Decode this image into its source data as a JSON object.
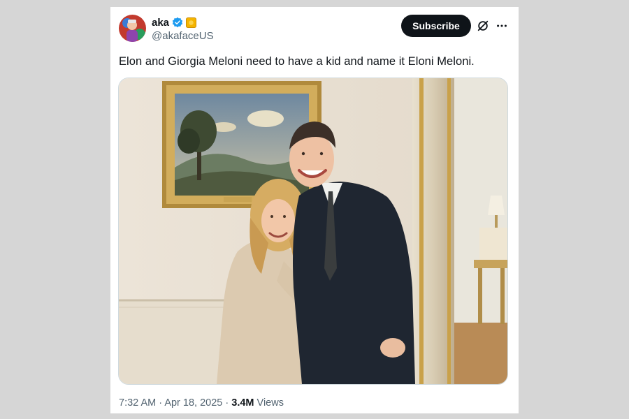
{
  "tweet": {
    "author": {
      "display_name": "aka",
      "handle": "@akafaceUS",
      "verified": true,
      "badge": "orange-square-badge",
      "avatar_icon": "avatar-icon"
    },
    "subscribe_label": "Subscribe",
    "text": "Elon and Giorgia Meloni need to have a kid and name it Eloni Meloni.",
    "time": "7:32 AM",
    "date": "Apr 18, 2025",
    "views_count": "3.4M",
    "views_label": "Views",
    "separator": "·"
  },
  "colors": {
    "subscribe_bg": "#0f1419",
    "verified": "#1d9bf0",
    "secondary_text": "#536471",
    "primary_text": "#0f1419"
  }
}
